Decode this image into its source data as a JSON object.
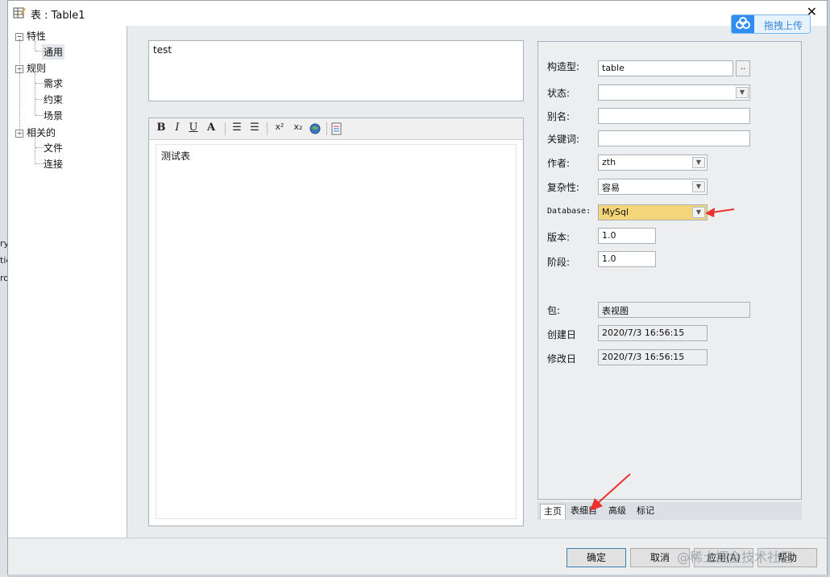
{
  "background_left_text": [
    "ry",
    "tic",
    "ro"
  ],
  "window": {
    "title": "表 : Table1",
    "close_glyph": "✕"
  },
  "upload": {
    "label": "拖拽上传"
  },
  "tree": {
    "groups": [
      {
        "label": "特性",
        "children": [
          "通用"
        ]
      },
      {
        "label": "规则",
        "children": [
          "需求",
          "约束",
          "场景"
        ]
      },
      {
        "label": "相关的",
        "children": [
          "文件",
          "连接"
        ]
      }
    ],
    "selected": "通用",
    "collapse_glyph": "−"
  },
  "summary": {
    "text": "test"
  },
  "toolbar": {
    "bold": "B",
    "italic": "I",
    "underline": "U",
    "font_color": "A",
    "bullet_list": "☰",
    "number_list": "☰",
    "superscript": "x²",
    "subscript": "x₂"
  },
  "editor": {
    "text": "测试表"
  },
  "properties": {
    "stereotype": {
      "label": "构造型:",
      "value": "table",
      "button": ".."
    },
    "status": {
      "label": "状态:",
      "value": ""
    },
    "alias": {
      "label": "别名:",
      "value": ""
    },
    "keywords": {
      "label": "关键词:",
      "value": ""
    },
    "author": {
      "label": "作者:",
      "value": "zth"
    },
    "complexity": {
      "label": "复杂性:",
      "value": "容易"
    },
    "database": {
      "label": "Database:",
      "value": "MySql"
    },
    "version": {
      "label": "版本:",
      "value": "1.0"
    },
    "phase": {
      "label": "阶段:",
      "value": "1.0"
    },
    "package": {
      "label": "包:",
      "value": "表视图"
    },
    "created": {
      "label": "创建日",
      "value": "2020/7/3 16:56:15"
    },
    "modified": {
      "label": "修改日",
      "value": "2020/7/3 16:56:15"
    }
  },
  "tabs": [
    "主页",
    "表细目",
    "高级",
    "标记"
  ],
  "active_tab": "主页",
  "buttons": {
    "ok": "确定",
    "cancel": "取消",
    "apply": "应用(A)",
    "help": "帮助"
  },
  "watermark": "@稀土掘金技术社区",
  "colors": {
    "highlight": "#f4d57a",
    "arrow": "#e8322b",
    "upload_blue": "#2f8ef0"
  }
}
